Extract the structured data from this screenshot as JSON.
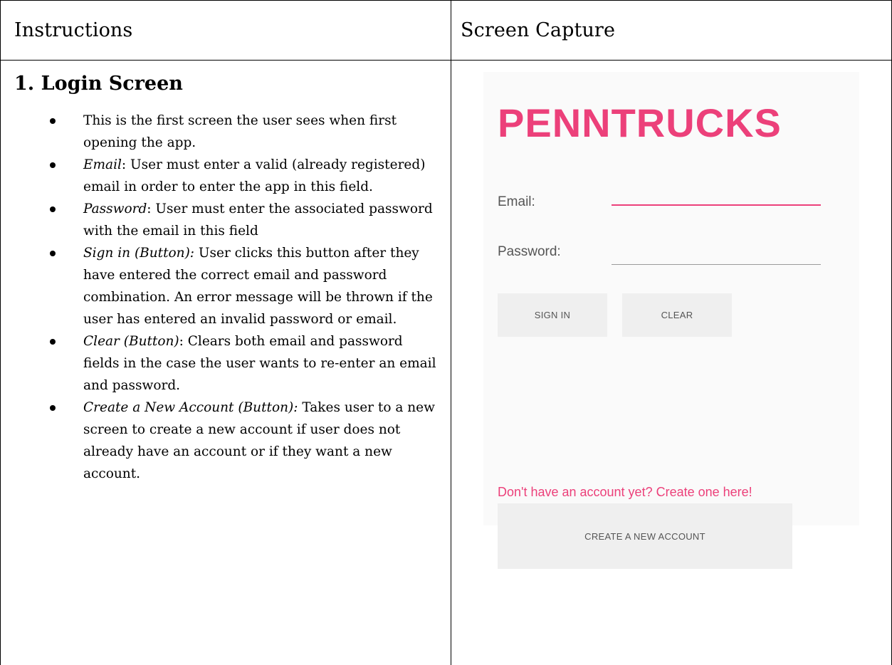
{
  "table": {
    "header_left": "Instructions",
    "header_right": "Screen Capture"
  },
  "instructions": {
    "title": "1. Login Screen",
    "bullets": [
      {
        "term": "",
        "text": "This is the first screen the user sees when first opening the app."
      },
      {
        "term": "Email",
        "text": ": User must enter a valid (already registered) email in order to enter the app in this field."
      },
      {
        "term": "Password",
        "text": ": User must enter the associated password with the email in this field"
      },
      {
        "term": "Sign in (Button):",
        "text": " User clicks this button after they have entered the correct email and password combination. An error message will be thrown if the user has entered an invalid password or email."
      },
      {
        "term": "Clear (Button)",
        "text": ": Clears both email and password fields in the case the user wants to re-enter an email and password."
      },
      {
        "term": "Create a New Account (Button):",
        "text": " Takes user to a new screen to create a new account if user does not already have an account or if they want a new account."
      }
    ]
  },
  "app": {
    "title": "PENNTRUCKS",
    "email_label": "Email:",
    "email_value": "",
    "password_label": "Password:",
    "password_value": "",
    "sign_in_label": "SIGN IN",
    "clear_label": "CLEAR",
    "signup_prompt": "Don't have an account yet? Create one here!",
    "create_account_label": "CREATE A NEW ACCOUNT"
  },
  "colors": {
    "accent": "#ec407a",
    "text": "#000000",
    "screen_bg": "#fafafa",
    "button_bg": "#efefef"
  }
}
